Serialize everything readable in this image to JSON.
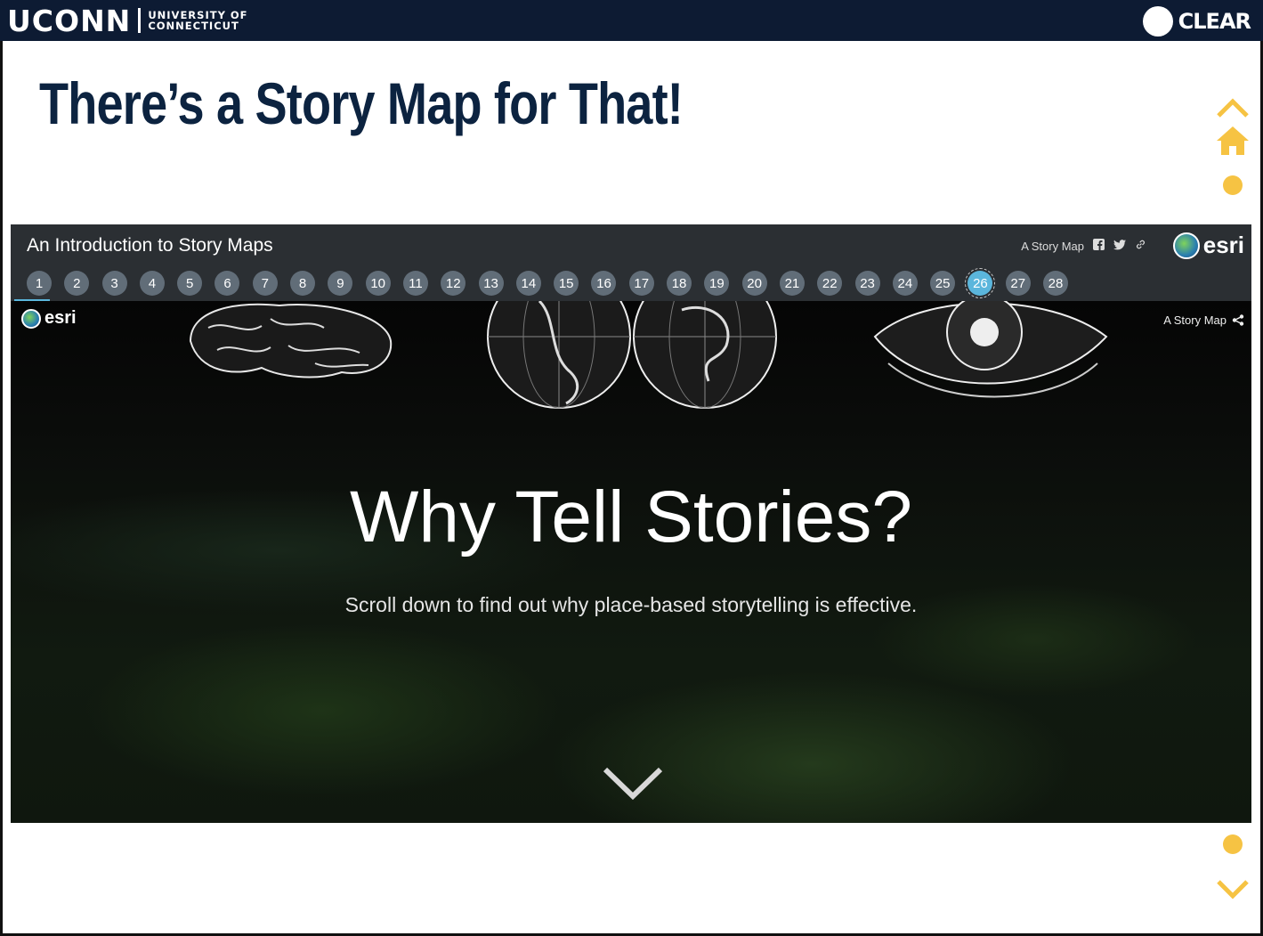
{
  "header": {
    "brand_word": "UCONN",
    "brand_sub_line1": "UNIVERSITY OF",
    "brand_sub_line2": "CONNECTICUT",
    "program_word": "CLEAR"
  },
  "slide": {
    "title": "There’s a Story Map for That!"
  },
  "story_map": {
    "title": "An Introduction to Story Maps",
    "tagline": "A Story Map",
    "esri_label": "esri",
    "tabs": [
      "1",
      "2",
      "3",
      "4",
      "5",
      "6",
      "7",
      "8",
      "9",
      "10",
      "11",
      "12",
      "13",
      "14",
      "15",
      "16",
      "17",
      "18",
      "19",
      "20",
      "21",
      "22",
      "23",
      "24",
      "25",
      "26",
      "27",
      "28"
    ],
    "active_tab": "26",
    "hero": {
      "tagline": "A Story Map",
      "esri_label": "esri",
      "heading": "Why Tell Stories?",
      "subheading": "Scroll down to find out why place-based storytelling is effective."
    }
  },
  "colors": {
    "uconn_navy": "#0d1b33",
    "title_navy": "#0c2340",
    "story_header": "#2b2f33",
    "tab_inactive": "#616d78",
    "tab_active": "#5bb6dc",
    "nav_accent": "#f6c343"
  },
  "icons": [
    "facebook-icon",
    "twitter-icon",
    "link-icon",
    "share-icon",
    "home-icon",
    "chevron-up-icon",
    "chevron-down-icon"
  ]
}
